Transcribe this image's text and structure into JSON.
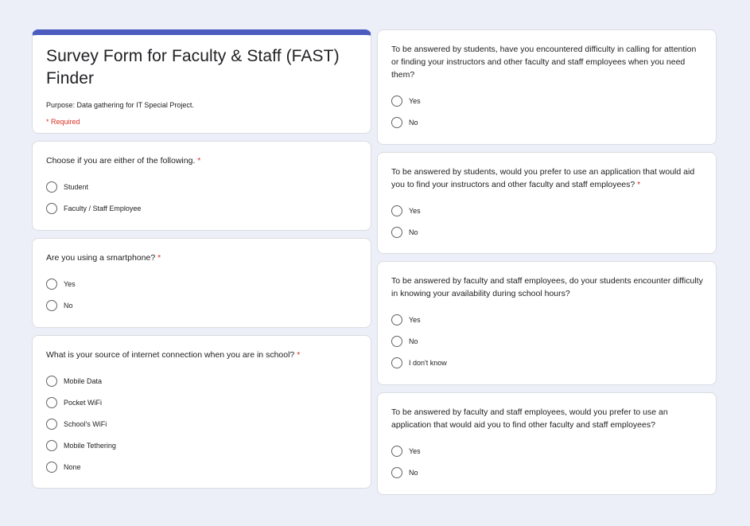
{
  "header": {
    "title": "Survey Form for Faculty & Staff (FAST) Finder",
    "description": "Purpose: Data gathering for IT Special Project.",
    "required_note": "* Required"
  },
  "required_marker": "*",
  "colors": {
    "accent": "#4c5bbf",
    "background": "#eceff8",
    "required": "#d93025"
  },
  "left_questions": [
    {
      "text": "Choose if you are either of the following.",
      "required": true,
      "options": [
        "Student",
        "Faculty / Staff Employee"
      ]
    },
    {
      "text": "Are you using a smartphone?",
      "required": true,
      "options": [
        "Yes",
        "No"
      ]
    },
    {
      "text": "What is your source of internet connection when you are in school?",
      "required": true,
      "options": [
        "Mobile Data",
        "Pocket WiFi",
        "School's WiFi",
        "Mobile Tethering",
        "None"
      ]
    }
  ],
  "right_questions": [
    {
      "text": "To be answered by students, have you encountered difficulty in calling for attention or finding your instructors and other faculty and staff employees when you need them?",
      "required": false,
      "options": [
        "Yes",
        "No"
      ]
    },
    {
      "text": "To be answered by students, would you prefer to use an application that would aid you to find your instructors and other faculty and staff employees?",
      "required": true,
      "options": [
        "Yes",
        "No"
      ]
    },
    {
      "text": "To be answered by faculty and staff employees, do your students encounter difficulty in knowing your availability during school hours?",
      "required": false,
      "options": [
        "Yes",
        "No",
        "I don't know"
      ]
    },
    {
      "text": "To be answered by faculty and staff employees, would you prefer to use an application that would aid you to find other faculty and staff employees?",
      "required": false,
      "options": [
        "Yes",
        "No"
      ]
    }
  ]
}
